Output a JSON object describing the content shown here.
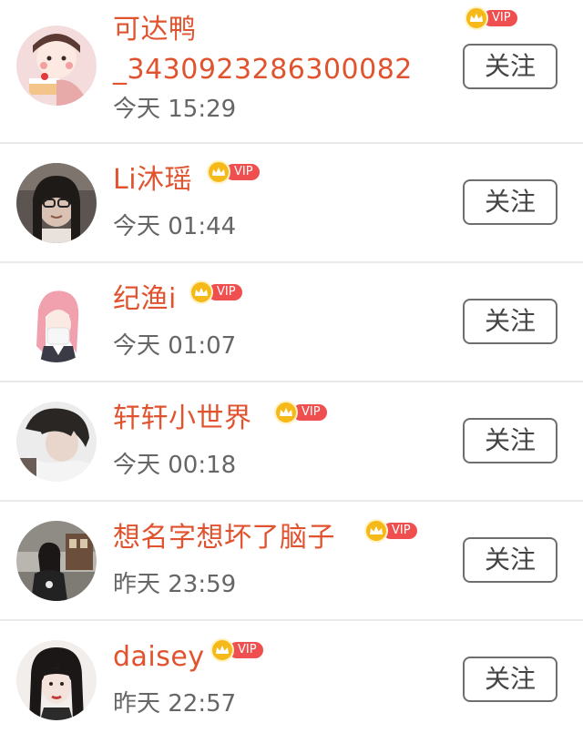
{
  "follow_label": "关注",
  "vip_label": "VIP",
  "colors": {
    "name": "#e0532e",
    "vip_pill": "#ef4f4f",
    "crown": "#f6b91a",
    "divider": "#eaeaea"
  },
  "users": [
    {
      "name": "可达鸭_3430923286300082",
      "time": "今天 15:29",
      "avatar": "cartoon-girl-cake-avatar"
    },
    {
      "name": "Li沐瑶",
      "time": "今天 01:44",
      "avatar": "girl-glasses-photo-avatar"
    },
    {
      "name": "纪渔i",
      "time": "今天 01:07",
      "avatar": "anime-pink-hair-avatar"
    },
    {
      "name": "轩轩小世界",
      "time": "今天 00:18",
      "avatar": "boy-photo-avatar"
    },
    {
      "name": "想名字想坏了脑子",
      "time": "昨天 23:59",
      "avatar": "street-photo-avatar"
    },
    {
      "name": "daisey",
      "time": "昨天 22:57",
      "avatar": "girl-portrait-avatar"
    }
  ]
}
